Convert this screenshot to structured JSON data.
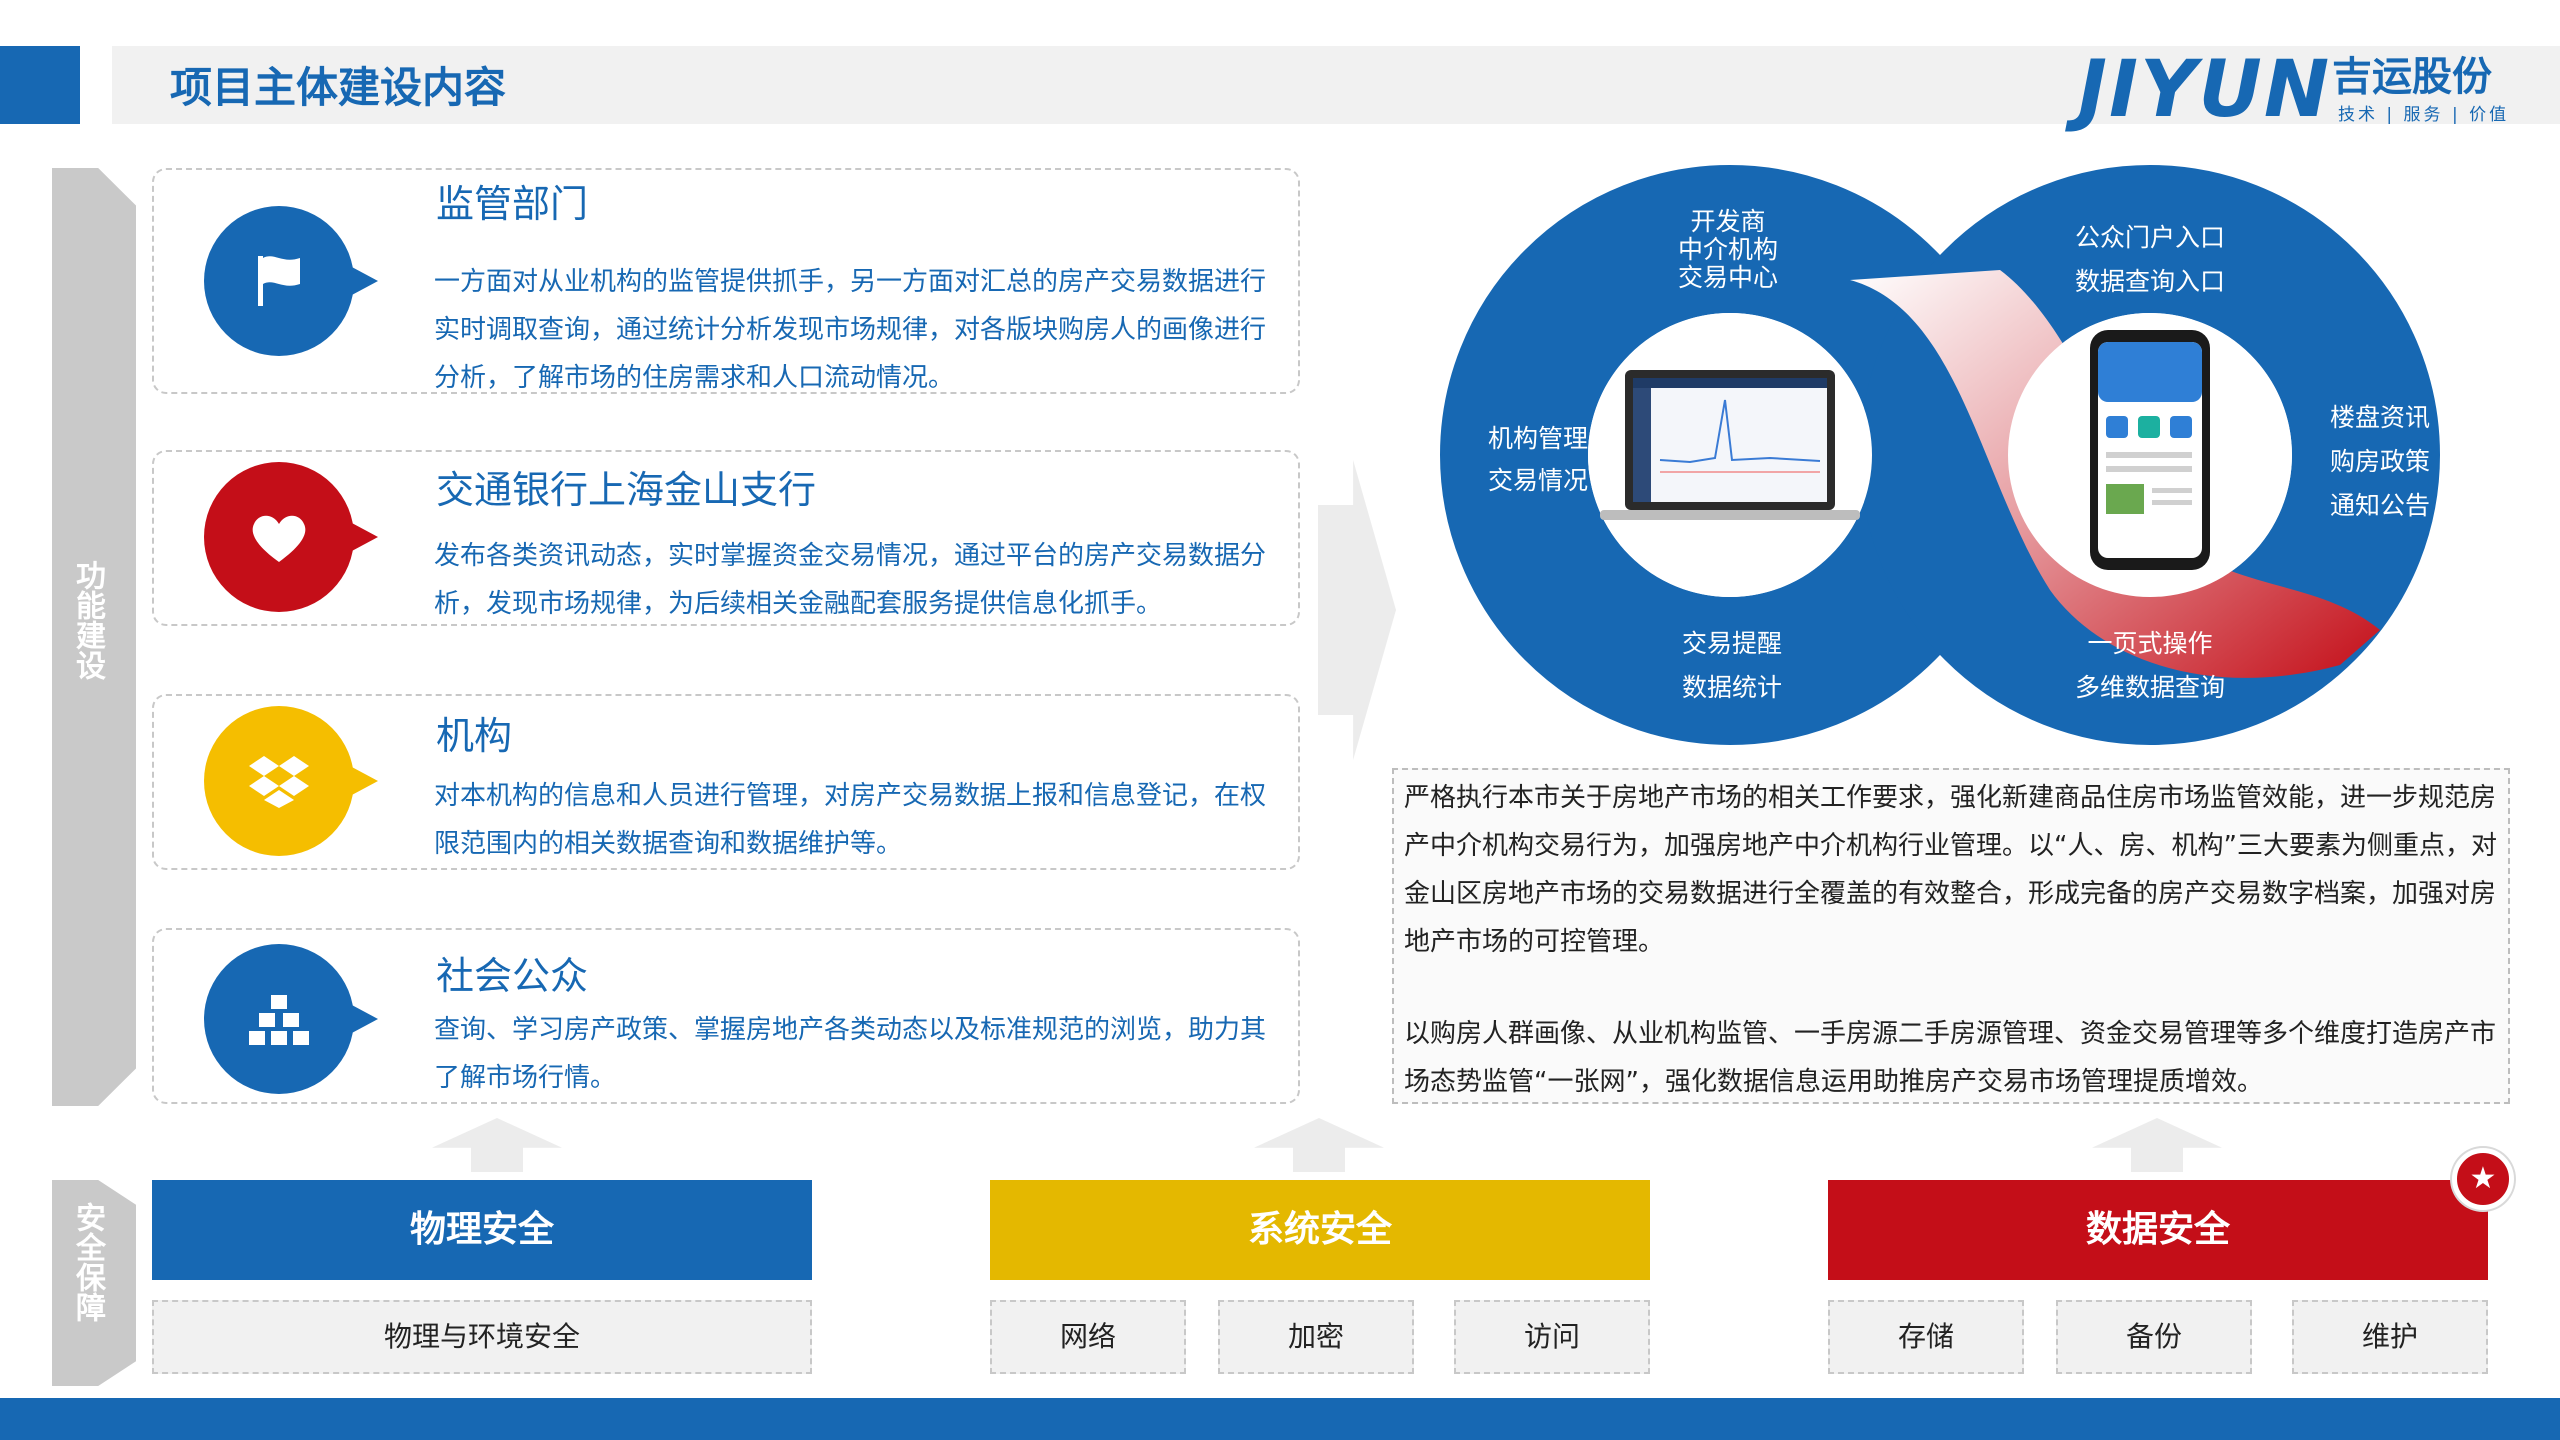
{
  "header": {
    "title": "项目主体建设内容",
    "logo_mark": "JIYUN",
    "logo_name": "吉运股份",
    "logo_tagline": "技术 | 服务 | 价值"
  },
  "sidebar": {
    "function_label": "功能建设",
    "security_label": "安全保障"
  },
  "cards": [
    {
      "title": "监管部门",
      "icon": "flag-icon",
      "body": "一方面对从业机构的监管提供抓手，另一方面对汇总的房产交易数据进行实时调取查询，通过统计分析发现市场规律，对各版块购房人的画像进行分析，了解市场的住房需求和人口流动情况。"
    },
    {
      "title": "交通银行上海金山支行",
      "icon": "heart-icon",
      "body": "发布各类资讯动态，实时掌握资金交易情况，通过平台的房产交易数据分析，发现市场规律，为后续相关金融配套服务提供信息化抓手。"
    },
    {
      "title": "机构",
      "icon": "dropbox-icon",
      "body": "对本机构的信息和人员进行管理，对房产交易数据上报和信息登记，在权限范围内的相关数据查询和数据维护等。"
    },
    {
      "title": "社会公众",
      "icon": "cubes-icon",
      "body": "查询、学习房产政策、掌握房地产各类动态以及标准规范的浏览，助力其了解市场行情。"
    }
  ],
  "diagram": {
    "left_top": [
      "开发商",
      "中介机构",
      "交易中心"
    ],
    "left_side": [
      "机构管理",
      "交易情况"
    ],
    "left_bottom": [
      "交易提醒",
      "数据统计"
    ],
    "right_top": [
      "公众门户入口",
      "数据查询入口"
    ],
    "right_side": [
      "楼盘资讯",
      "购房政策",
      "通知公告"
    ],
    "right_bottom": [
      "一页式操作",
      "多维数据查询"
    ]
  },
  "summary": {
    "para1": "严格执行本市关于房地产市场的相关工作要求，强化新建商品住房市场监管效能，进一步规范房产中介机构交易行为，加强房地产中介机构行业管理。以“人、房、机构”三大要素为侧重点，对金山区房地产市场的交易数据进行全覆盖的有效整合，形成完备的房产交易数字档案，加强对房地产市场的可控管理。",
    "para2": "以购房人群画像、从业机构监管、一手房源二手房源管理、资金交易管理等多个维度打造房产市场态势监管“一张网”，强化数据信息运用助推房产交易市场管理提质增效。"
  },
  "security": [
    {
      "title": "物理安全",
      "items": [
        "物理与环境安全"
      ]
    },
    {
      "title": "系统安全",
      "items": [
        "网络",
        "加密",
        "访问"
      ]
    },
    {
      "title": "数据安全",
      "items": [
        "存储",
        "备份",
        "维护"
      ]
    }
  ],
  "colors": {
    "primary_blue": "#1768b3",
    "accent_red": "#c40e18",
    "accent_yellow": "#f5be00",
    "neutral_gray": "#c9c9c9"
  }
}
